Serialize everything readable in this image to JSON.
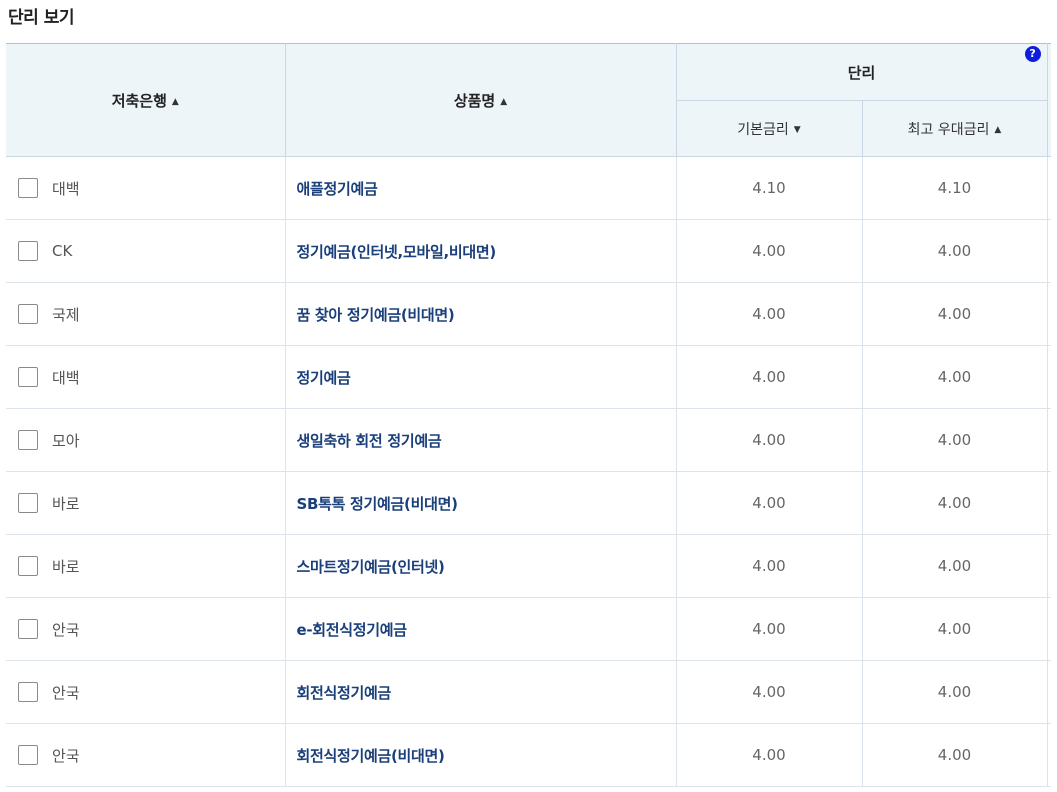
{
  "section": {
    "title": "단리 보기"
  },
  "header": {
    "bank": "저축은행",
    "product": "상품명",
    "rate_group": "단리",
    "base_rate": "기본금리",
    "max_rate": "최고 우대금리",
    "help": "?",
    "sort_up": "▲",
    "sort_down": "▼"
  },
  "rows": [
    {
      "bank": "대백",
      "product": "애플정기예금",
      "base": "4.10",
      "max": "4.10"
    },
    {
      "bank": "CK",
      "product": "정기예금(인터넷,모바일,비대면)",
      "base": "4.00",
      "max": "4.00"
    },
    {
      "bank": "국제",
      "product": "꿈 찾아 정기예금(비대면)",
      "base": "4.00",
      "max": "4.00"
    },
    {
      "bank": "대백",
      "product": "정기예금",
      "base": "4.00",
      "max": "4.00"
    },
    {
      "bank": "모아",
      "product": "생일축하 회전 정기예금",
      "base": "4.00",
      "max": "4.00"
    },
    {
      "bank": "바로",
      "product": "SB톡톡 정기예금(비대면)",
      "base": "4.00",
      "max": "4.00"
    },
    {
      "bank": "바로",
      "product": "스마트정기예금(인터넷)",
      "base": "4.00",
      "max": "4.00"
    },
    {
      "bank": "안국",
      "product": "e-회전식정기예금",
      "base": "4.00",
      "max": "4.00"
    },
    {
      "bank": "안국",
      "product": "회전식정기예금",
      "base": "4.00",
      "max": "4.00"
    },
    {
      "bank": "안국",
      "product": "회전식정기예금(비대면)",
      "base": "4.00",
      "max": "4.00"
    }
  ]
}
